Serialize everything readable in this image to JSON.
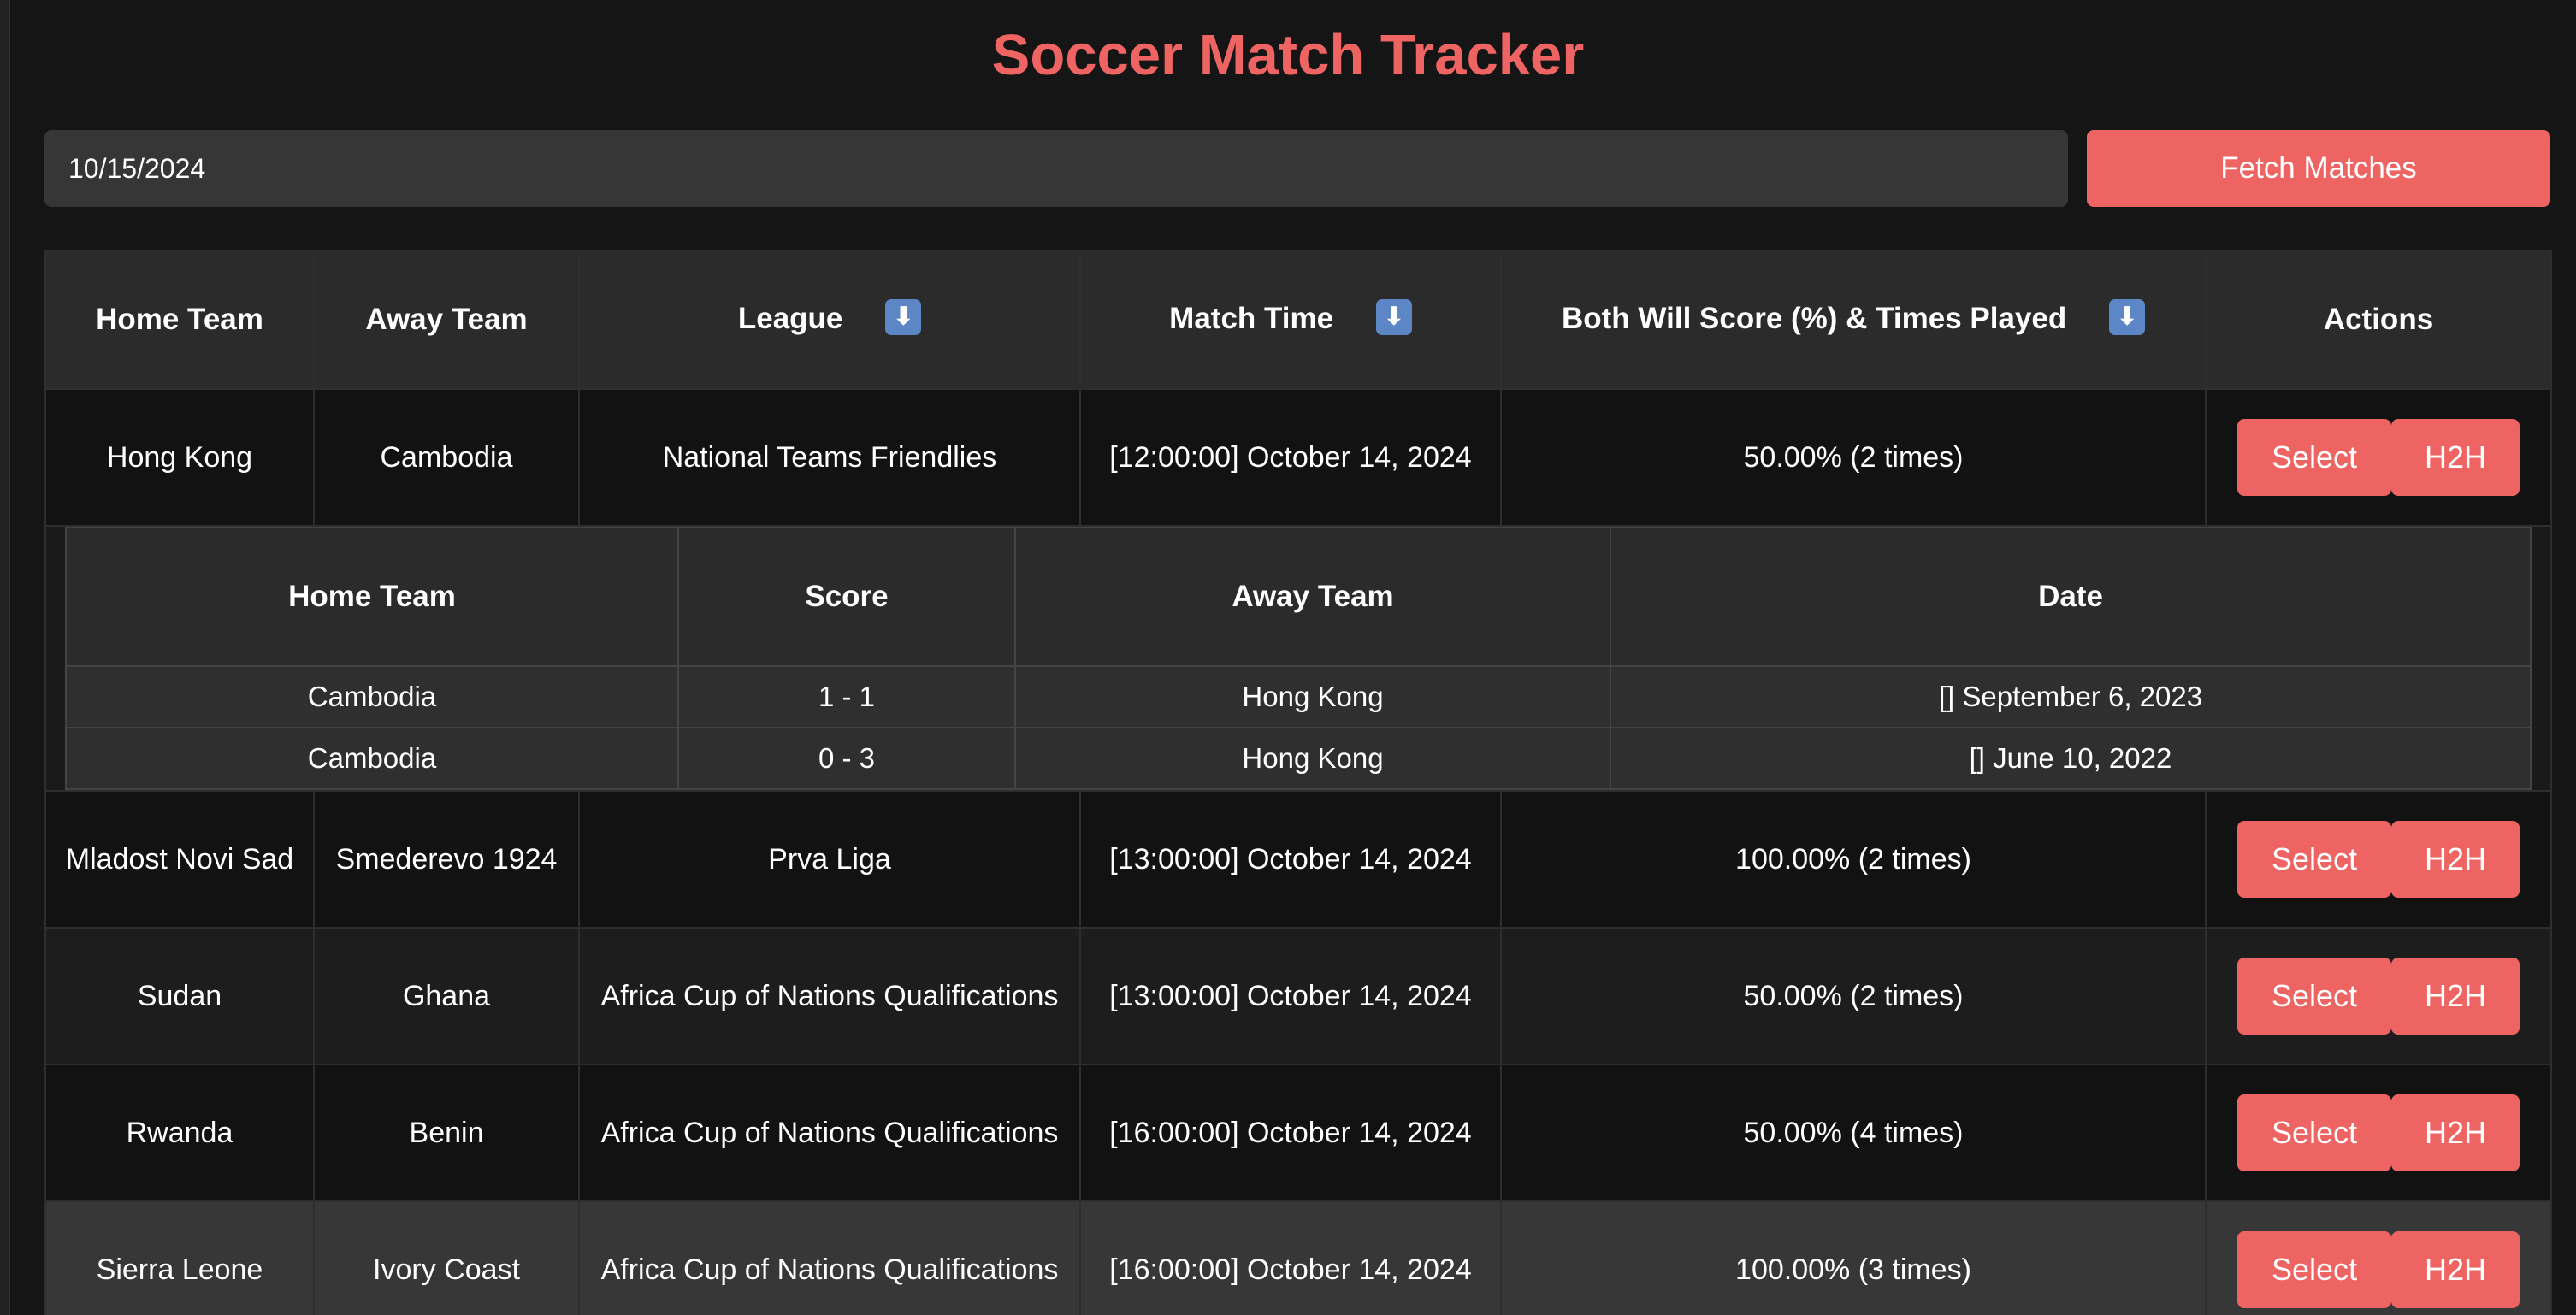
{
  "title": "Soccer Match Tracker",
  "date_input": {
    "value": "10/15/2024"
  },
  "fetch_button": "Fetch Matches",
  "sort_icon": "⬇",
  "table": {
    "headers": {
      "home": "Home Team",
      "away": "Away Team",
      "league": "League",
      "time": "Match Time",
      "bts": "Both Will Score (%) & Times Played",
      "actions": "Actions"
    },
    "rows": [
      {
        "home": "Hong Kong",
        "away": "Cambodia",
        "league": "National Teams Friendlies",
        "time": "[12:00:00] October 14, 2024",
        "bts": "50.00% (2 times)"
      },
      {
        "home": "Mladost Novi Sad",
        "away": "Smederevo 1924",
        "league": "Prva Liga",
        "time": "[13:00:00] October 14, 2024",
        "bts": "100.00% (2 times)"
      },
      {
        "home": "Sudan",
        "away": "Ghana",
        "league": "Africa Cup of Nations Qualifications",
        "time": "[13:00:00] October 14, 2024",
        "bts": "50.00% (2 times)"
      },
      {
        "home": "Rwanda",
        "away": "Benin",
        "league": "Africa Cup of Nations Qualifications",
        "time": "[16:00:00] October 14, 2024",
        "bts": "50.00% (4 times)"
      },
      {
        "home": "Sierra Leone",
        "away": "Ivory Coast",
        "league": "Africa Cup of Nations Qualifications",
        "time": "[16:00:00] October 14, 2024",
        "bts": "100.00% (3 times)"
      }
    ],
    "actions": {
      "select": "Select",
      "h2h": "H2H"
    }
  },
  "h2h": {
    "headers": {
      "home": "Home Team",
      "score": "Score",
      "away": "Away Team",
      "date": "Date"
    },
    "rows": [
      {
        "home": "Cambodia",
        "score": "1 - 1",
        "away": "Hong Kong",
        "date": "[] September 6, 2023"
      },
      {
        "home": "Cambodia",
        "score": "0 - 3",
        "away": "Hong Kong",
        "date": "[] June 10, 2022"
      }
    ]
  },
  "colors": {
    "accent": "#ee6462",
    "background": "#151515",
    "header_bg": "#2b2b2b",
    "sort_icon_bg": "#5d86c6"
  }
}
